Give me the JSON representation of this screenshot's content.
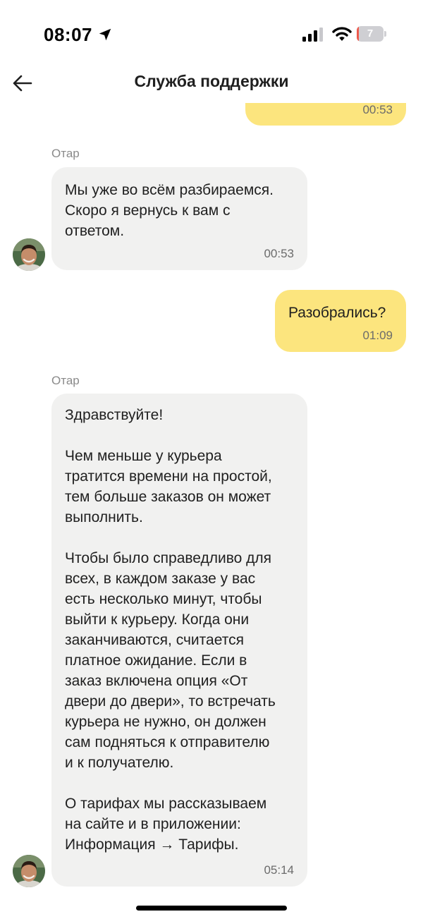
{
  "status_bar": {
    "time": "08:07",
    "battery_level": "7",
    "battery_fraction": 0.07,
    "icons": [
      "location-arrow-icon",
      "signal-icon",
      "wifi-icon",
      "battery-icon"
    ]
  },
  "header": {
    "title": "Служба поддержки",
    "back_icon": "arrow-left-icon"
  },
  "colors": {
    "outgoing_bubble": "#fce57e",
    "incoming_bubble": "#f1f1f0",
    "battery_low": "#ee5a4d"
  },
  "messages": [
    {
      "direction": "out",
      "text": "",
      "time": "00:53"
    },
    {
      "direction": "in",
      "sender": "Отар",
      "text": "Мы уже во всём разбираемся.\nСкоро я вернусь к вам с\nответом.",
      "time": "00:53"
    },
    {
      "direction": "out",
      "text": "Разобрались?",
      "time": "01:09"
    },
    {
      "direction": "in",
      "sender": "Отар",
      "text": "Здравствуйте!\n\nЧем меньше у курьера\nтратится времени на простой,\nтем больше заказов он может\nвыполнить.\n\nЧтобы было справедливо для\nвсех, в каждом заказе у вас\nесть несколько минут, чтобы\nвыйти к курьеру. Когда они\nзаканчиваются, считается\nплатное ожидание. Если в\nзаказ включена опция «От\nдвери до двери», то встречать\nкурьера не нужно, он должен\nсам подняться к отправителю\nи к получателю.\n\nО тарифах мы рассказываем\nна сайте и в приложении:\nИнформация → Тарифы.",
      "time": "05:14"
    }
  ]
}
